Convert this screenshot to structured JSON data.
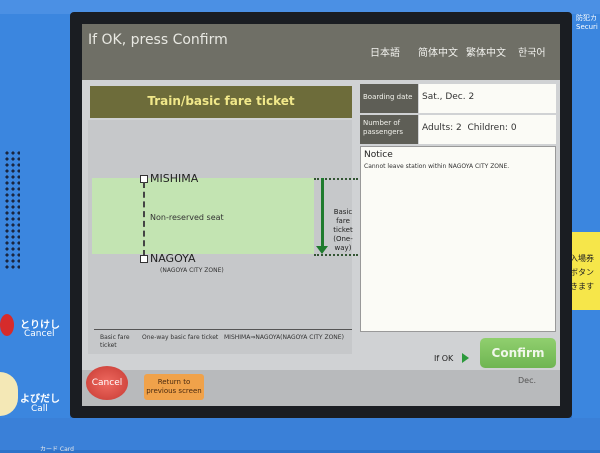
{
  "screen": {
    "prompt": "If OK, press Confirm",
    "languages": [
      "日本語",
      "简体中文",
      "繁体中文",
      "한국어"
    ],
    "ticket_title": "Train/basic fare ticket",
    "route": {
      "from_station": "MISHIMA",
      "to_station": "NAGOYA",
      "to_station_zone": "(NAGOYA CITY ZONE)",
      "seat": "Non-reserved seat",
      "fare_type": "Basic fare ticket (One-way)"
    },
    "summary": {
      "type": "Basic fare ticket",
      "kind": "One-way basic fare ticket",
      "route": "MISHIMA⇒NAGOYA(NAGOYA CITY ZONE)"
    },
    "info": {
      "boarding_date_label": "Boarding date",
      "boarding_date_value": "Sat., Dec. 2",
      "passengers_label": "Number of passengers",
      "passengers_value": "Adults: 2  Children: 0"
    },
    "notice": {
      "title": "Notice",
      "text": "Cannot leave station within NAGOYA CITY ZONE."
    },
    "if_ok_label": "If OK",
    "confirm_label": "Confirm",
    "cancel_label": "Cancel",
    "return_label": "Return to previous screen",
    "corner_date": "Dec."
  },
  "hardware": {
    "torikeshi": "とりけし",
    "cancel": "Cancel",
    "yobidashi": "よびだし",
    "call": "Call",
    "right_top": "防犯カ",
    "right_top_sub": "Securi",
    "sticker": [
      "入場券",
      "ボタン",
      "きます"
    ],
    "bottom_label": "カード  Card"
  },
  "colors": {
    "machine_blue": "#3b86df",
    "topbar": "#6f6f66",
    "title_bar": "#6d6c3a",
    "title_text": "#f1e88a",
    "zone_green": "#c3e4b2",
    "confirm_green": "#6fb552",
    "cancel_red": "#c63a33",
    "return_orange": "#f0a24a"
  }
}
